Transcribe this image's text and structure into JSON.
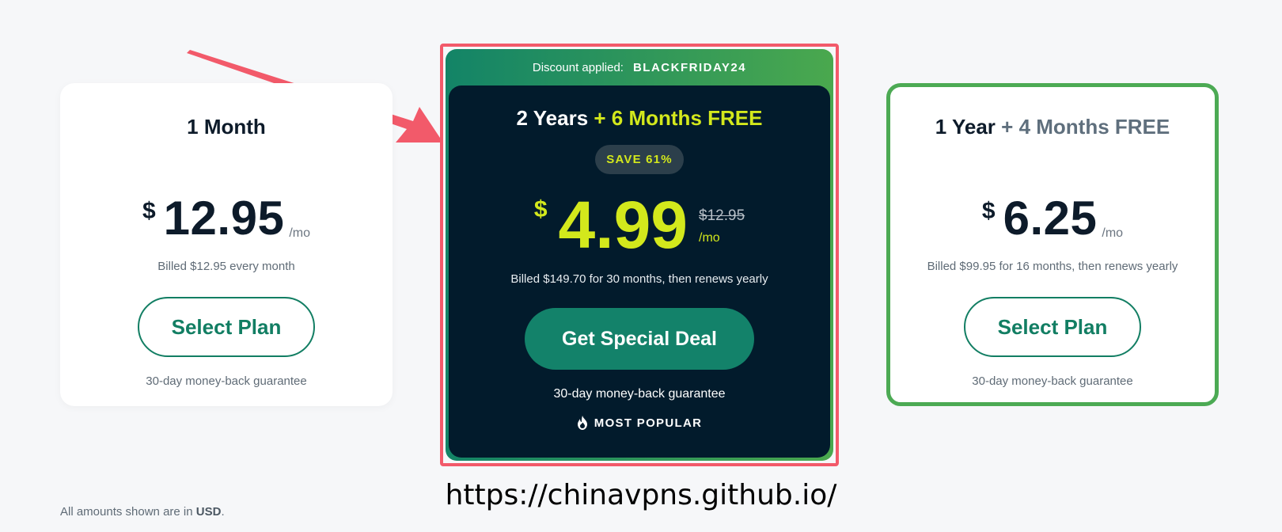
{
  "plans": {
    "month": {
      "title": "1 Month",
      "currency": "$",
      "price": "12.95",
      "per": "/mo",
      "billed": "Billed $12.95 every month",
      "button": "Select Plan",
      "guarantee": "30-day money-back guarantee"
    },
    "featured": {
      "discount_label": "Discount applied:",
      "discount_code": "BLACKFRIDAY24",
      "title_main": "2 Years",
      "title_bonus": "+ 6 Months FREE",
      "save_badge": "SAVE 61%",
      "currency": "$",
      "price": "4.99",
      "old_price": "$12.95",
      "per": "/mo",
      "billed": "Billed $149.70 for 30 months, then renews yearly",
      "button": "Get Special Deal",
      "guarantee": "30-day money-back guarantee",
      "popular": "MOST POPULAR"
    },
    "year": {
      "title_main": "1 Year",
      "title_bonus": "+ 4 Months FREE",
      "currency": "$",
      "price": "6.25",
      "per": "/mo",
      "billed": "Billed $99.95 for 16 months, then renews yearly",
      "button": "Select Plan",
      "guarantee": "30-day money-back guarantee"
    }
  },
  "overlay": {
    "url": "https://chinavpns.github.io/"
  },
  "footnote": {
    "prefix": "All amounts shown are in",
    "currency": "USD",
    "suffix": "."
  },
  "colors": {
    "accent_green": "#127e63",
    "highlight_yellow": "#d3e81c",
    "featured_bg": "#021b2c",
    "frame_red": "#f25a6a",
    "year_border": "#4caa54"
  },
  "icons": [
    "flame-icon",
    "arrow-annotation"
  ]
}
